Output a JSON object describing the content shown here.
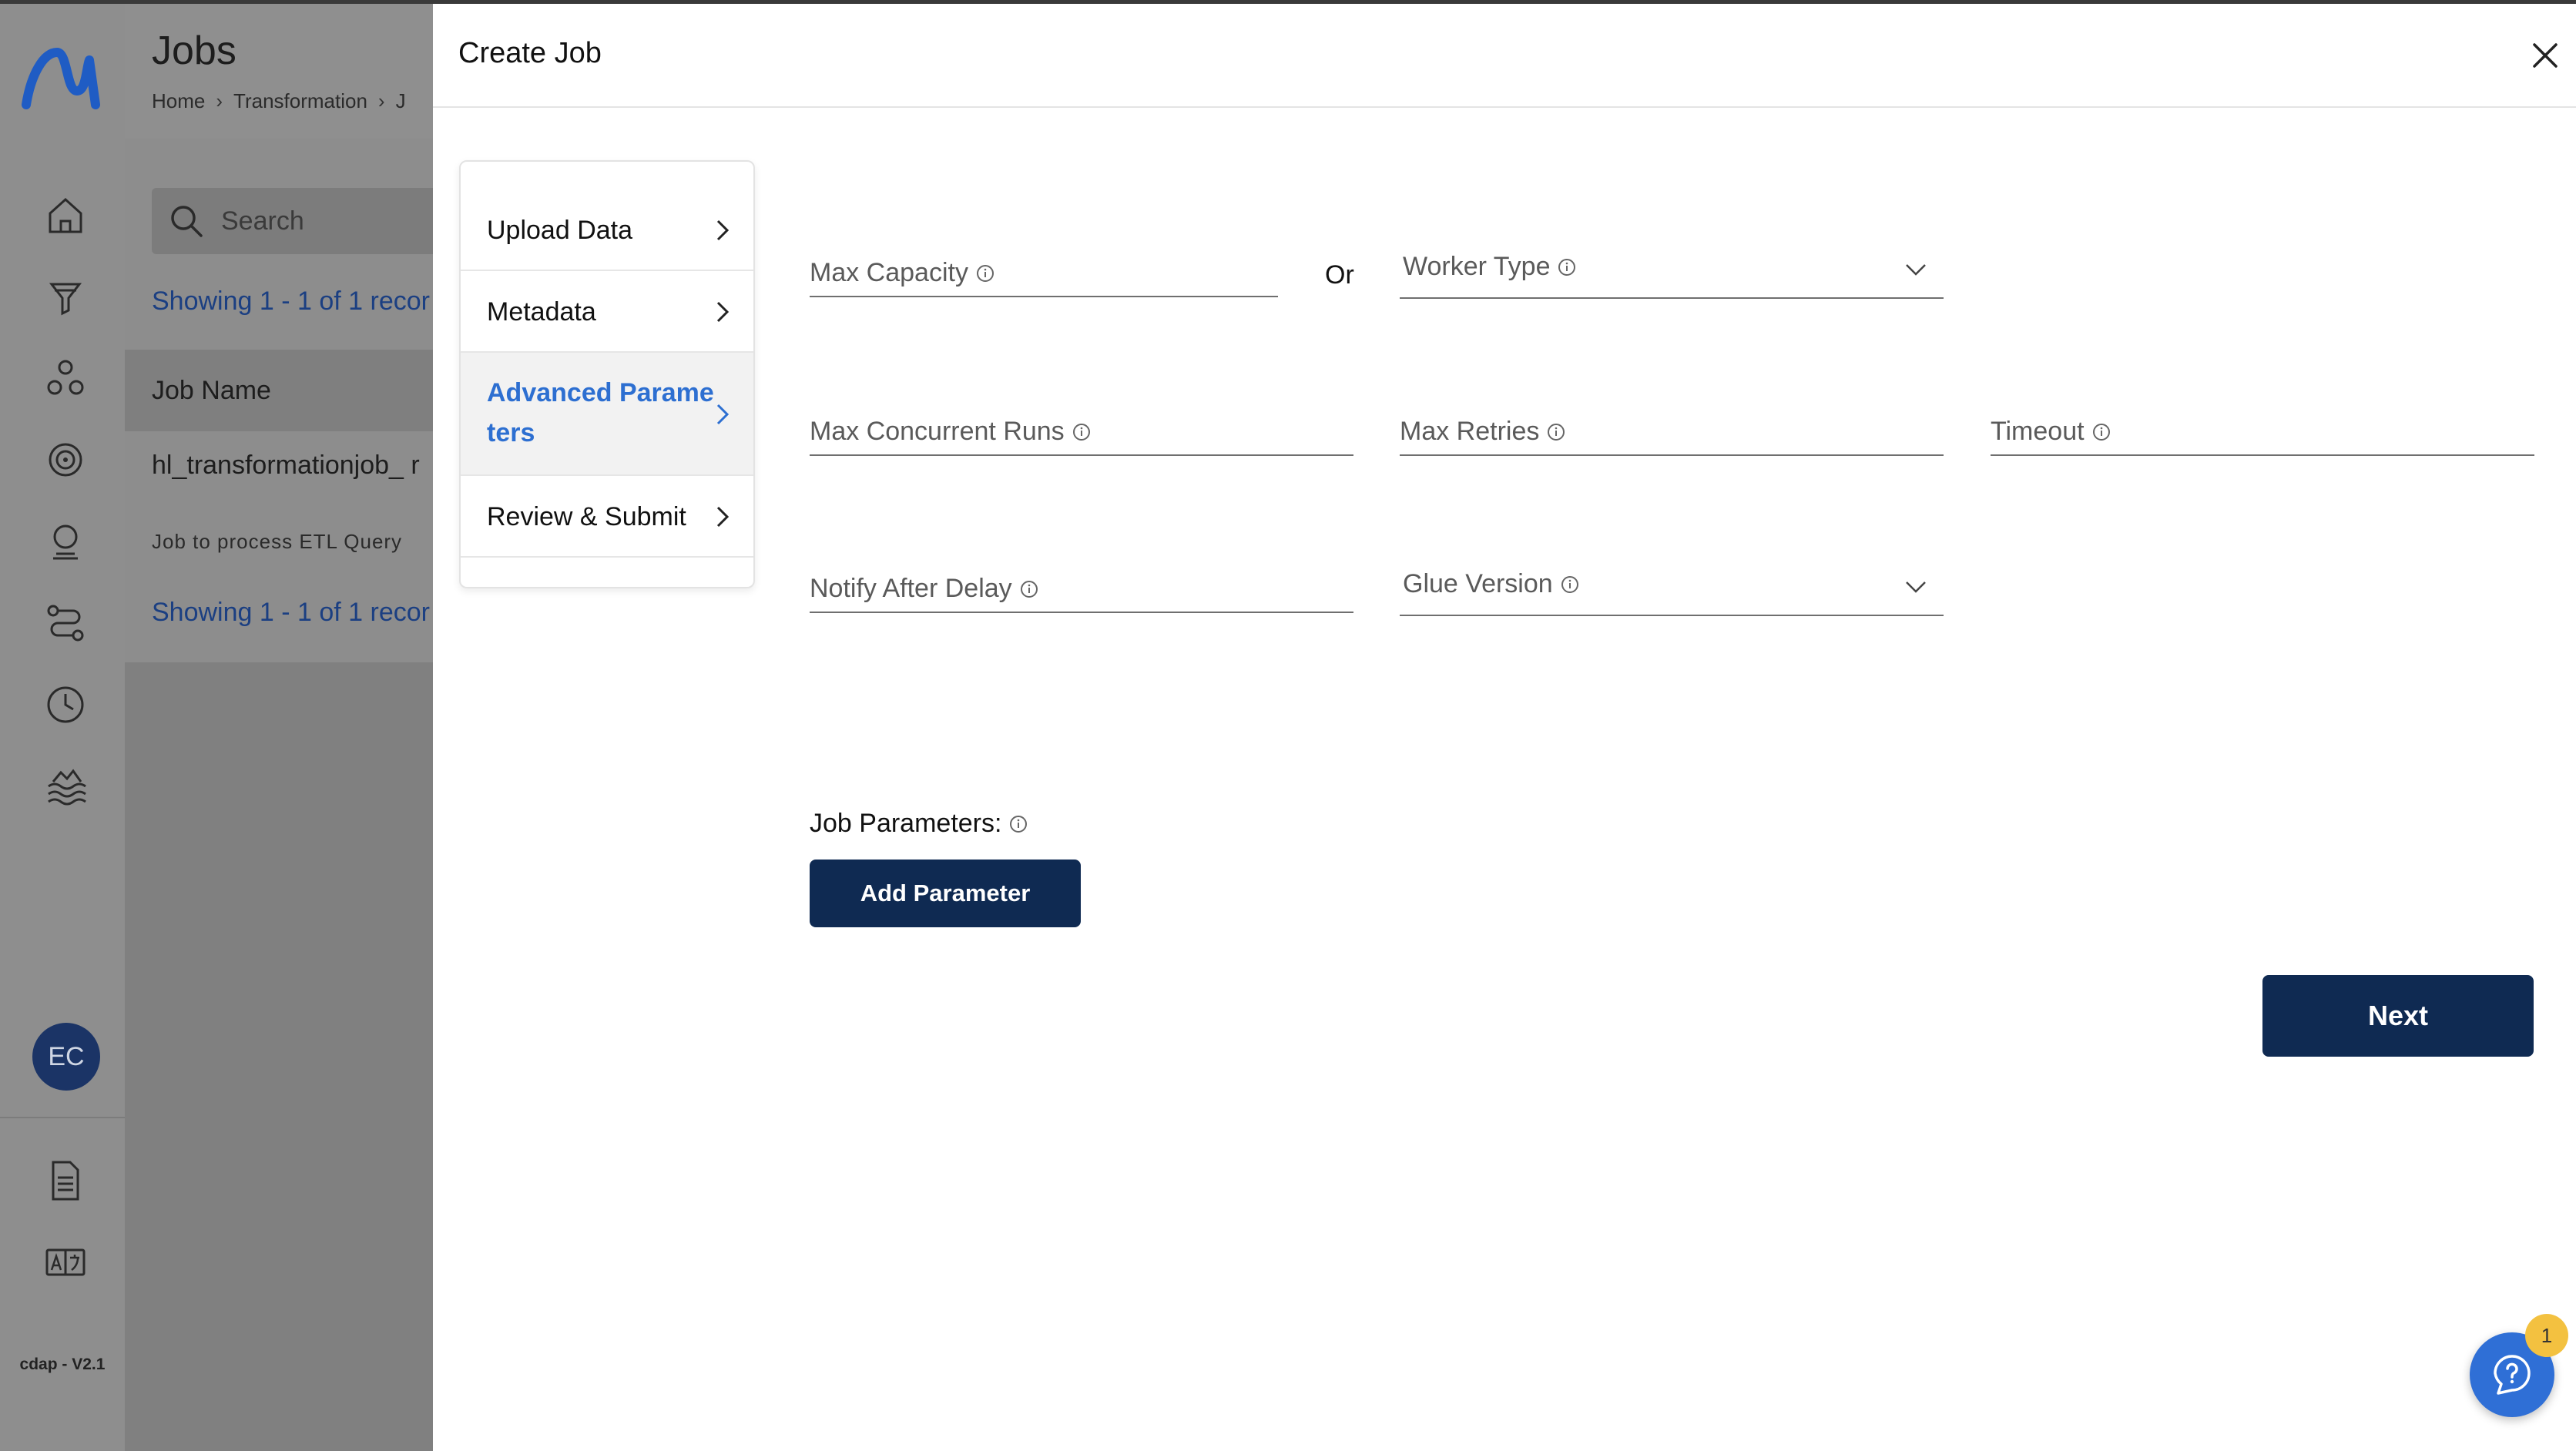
{
  "app": {
    "version": "cdap - V2.1",
    "avatar_initials": "EC",
    "brand_color": "#1f5cc4"
  },
  "background_page": {
    "title": "Jobs",
    "breadcrumbs": [
      "Home",
      "Transformation",
      "J"
    ],
    "search_placeholder": "Search",
    "showing_text": "Showing 1 - 1 of 1 recor",
    "column_header": "Job Name",
    "row": {
      "name": "hl_transformationjob_ r",
      "description": "Job to process ETL Query"
    }
  },
  "drawer": {
    "title": "Create Job",
    "steps": [
      {
        "label": "Upload Data"
      },
      {
        "label": "Metadata"
      },
      {
        "label": "Advanced Parameters"
      },
      {
        "label": "Review & Submit"
      }
    ],
    "fields": {
      "max_capacity": "Max Capacity",
      "or_text": "Or",
      "worker_type": "Worker Type",
      "max_concurrent_runs": "Max Concurrent Runs",
      "max_retries": "Max Retries",
      "timeout": "Timeout",
      "notify_after_delay": "Notify After Delay",
      "glue_version": "Glue Version"
    },
    "job_parameters_label": "Job Parameters:",
    "add_parameter_label": "Add Parameter",
    "next_label": "Next",
    "accent_color": "#0f2a52",
    "active_step_color": "#2d6fd1"
  },
  "help": {
    "badge_count": "1"
  }
}
